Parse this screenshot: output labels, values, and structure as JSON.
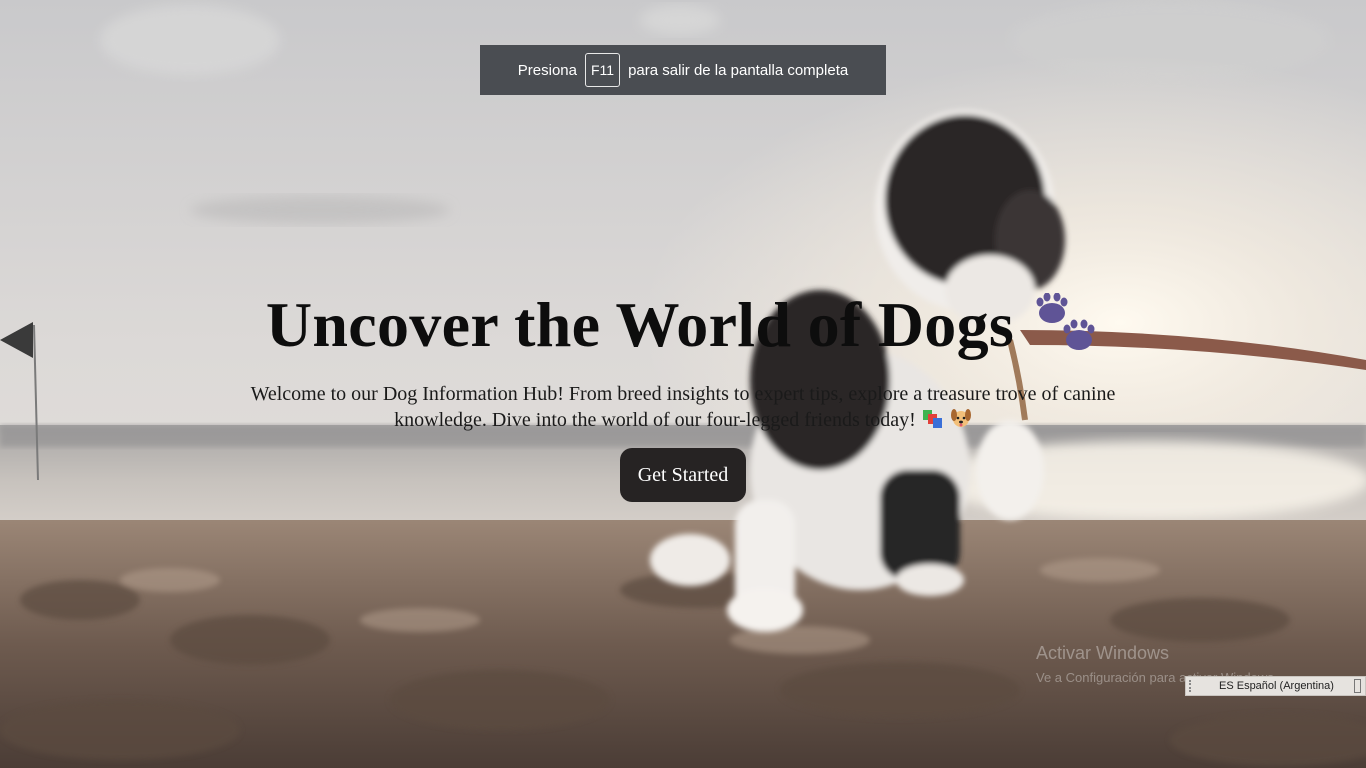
{
  "fullscreen_notice": {
    "prefix": "Presiona",
    "key": "F11",
    "suffix": "para salir de la pantalla completa"
  },
  "hero": {
    "title": "Uncover the World of Dogs",
    "title_icon": "paw-prints-icon",
    "subtitle": "Welcome to our Dog Information Hub! From breed insights to expert tips, explore a treasure trove of canine knowledge. Dive into the world of our four-legged friends today!",
    "subtitle_icons": [
      "books-icon",
      "dog-face-icon"
    ],
    "cta_label": "Get Started"
  },
  "windows": {
    "activation_title": "Activar Windows",
    "activation_sub": "Ve a Configuración para activar Windows.",
    "language": "ES Español (Argentina)"
  },
  "colors": {
    "title": "#0d0d0d",
    "cta_bg": "#262323",
    "paw": "#5f5496",
    "toast_bg": "#4a4d52"
  }
}
